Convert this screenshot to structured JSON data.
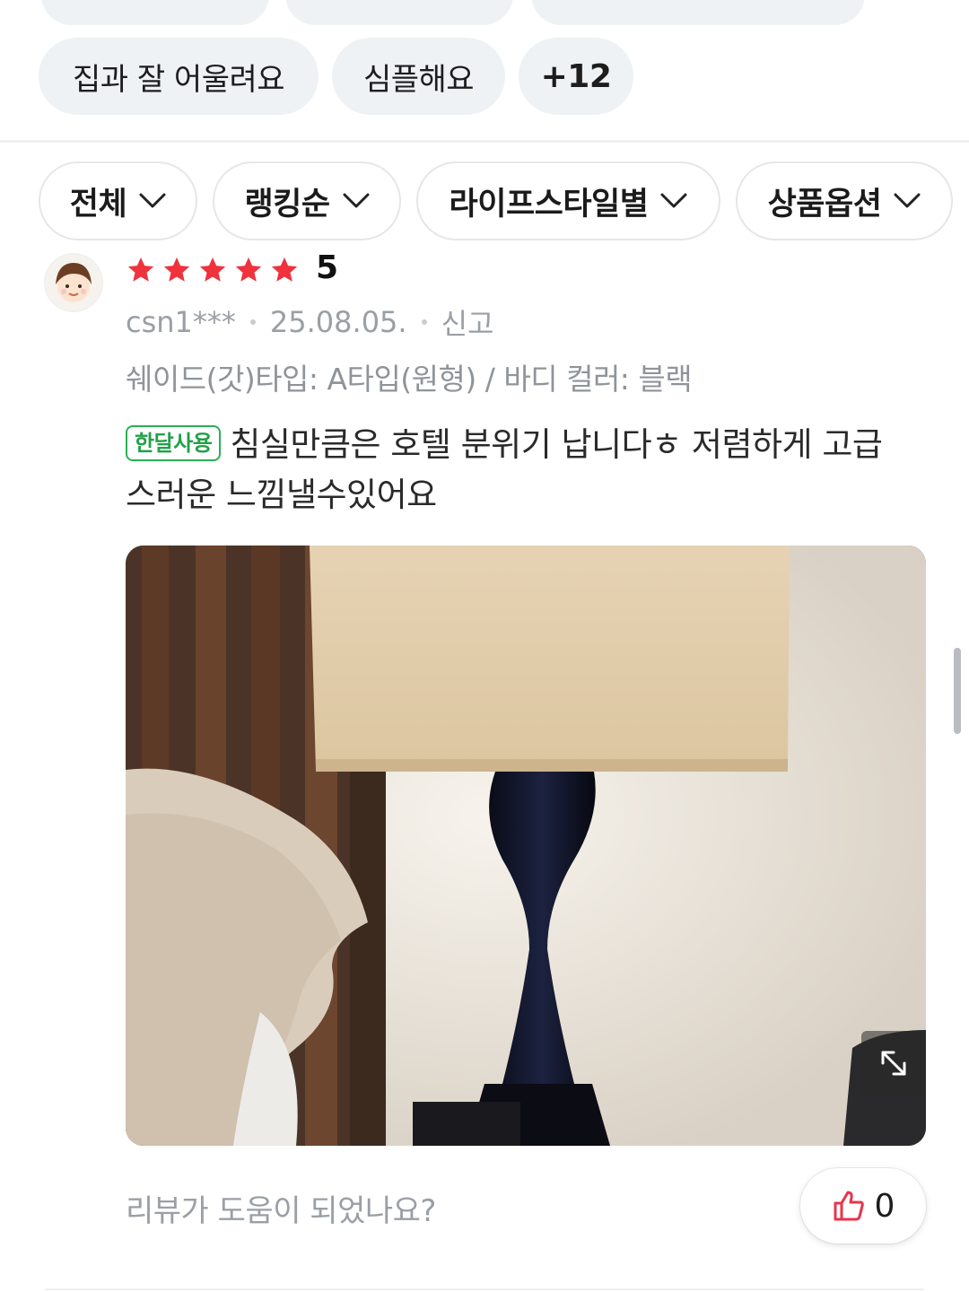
{
  "keyword_chips": [
    {
      "label": "집과 잘 어울려요"
    },
    {
      "label": "심플해요"
    },
    {
      "label": "+12"
    }
  ],
  "filters": [
    {
      "label": "전체"
    },
    {
      "label": "랭킹순"
    },
    {
      "label": "라이프스타일별"
    },
    {
      "label": "상품옵션"
    }
  ],
  "review": {
    "rating": "5",
    "star_count": 5,
    "user": "csn1***",
    "date": "25.08.05.",
    "report_label": "신고",
    "option_text": "쉐이드(갓)타입: A타입(원형) / 바디 컬러: 블랙",
    "badge": "한달사용",
    "text": "침실만큼은 호텔 분위기 납니다ㅎ 저렴하게 고급스러운 느낌낼수있어요",
    "photo_icon": "expand-icon"
  },
  "helpful": {
    "question": "리뷰가 도움이 되었나요?",
    "like_count": "0",
    "icon": "thumbs-up-icon"
  },
  "colors": {
    "star": "#f0323c",
    "badge_green": "#23a04a",
    "like_red": "#e8344a",
    "chip_bg": "#eef2f5"
  }
}
